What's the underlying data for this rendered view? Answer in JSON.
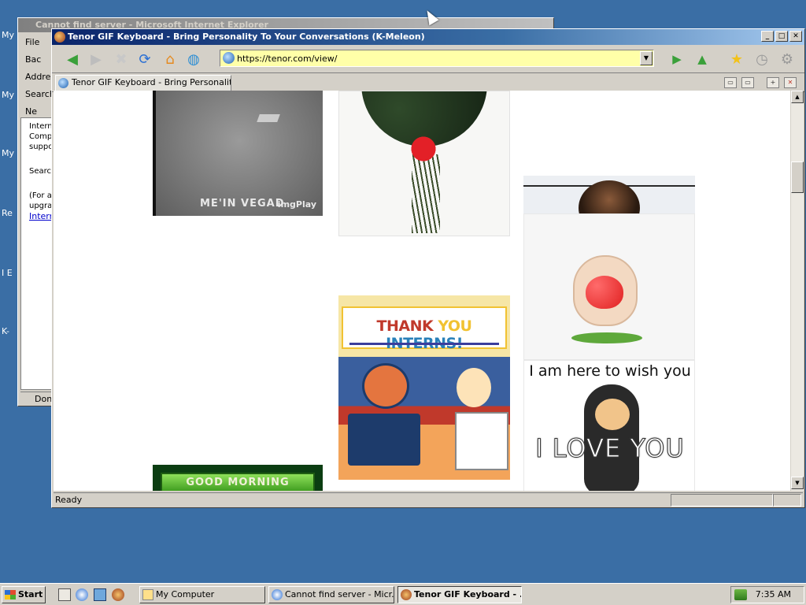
{
  "desktop": {
    "icons": [
      "My D",
      "My",
      "My",
      "Re",
      "I\nE",
      "K-"
    ]
  },
  "ie_window": {
    "title": "Cannot find server - Microsoft Internet Explorer",
    "menu_file": "File",
    "back": "Bac",
    "address": "Address",
    "search_tab": "Search",
    "new_btn": "Ne",
    "panel_text_1": "Intern\nComp\nsuppo",
    "panel_text_2": "Searc",
    "panel_text_3": "(For a\nupgra",
    "panel_link": "Intern",
    "status": "Don"
  },
  "browser": {
    "title": "Tenor GIF Keyboard - Bring Personality To Your Conversations (K-Meleon)",
    "url": "https://tenor.com/view/",
    "tab_label": "Tenor GIF Keyboard - Bring Personality...",
    "status": "Ready",
    "toolbar_icons": [
      "back-icon",
      "forward-icon",
      "stop-icon",
      "reload-icon",
      "home-icon",
      "globe-icon",
      "go-icon",
      "up-icon",
      "bookmarks-icon",
      "history-icon",
      "settings-icon"
    ]
  },
  "gifs": {
    "vegas_watermark": "ME'IN VEGAD",
    "vegas_brand": "imgPlay",
    "thanks_part1": "THANK ",
    "thanks_part2": "YOU ",
    "thanks_part3": "INTERNS!",
    "monkey_caption": "I am here to wish you",
    "monkey_big": "I LOVE YOU",
    "morning": "GOOD MORNING"
  },
  "taskbar": {
    "start": "Start",
    "tasks": [
      {
        "label": "My Computer"
      },
      {
        "label": "Cannot find server - Micr..."
      },
      {
        "label": "Tenor GIF Keyboard - ..."
      }
    ],
    "clock": "7:35 AM"
  },
  "colors": {
    "desktop": "#3a6ea5",
    "active_title": "#0a246a",
    "url_bg": "#ffffa8"
  }
}
